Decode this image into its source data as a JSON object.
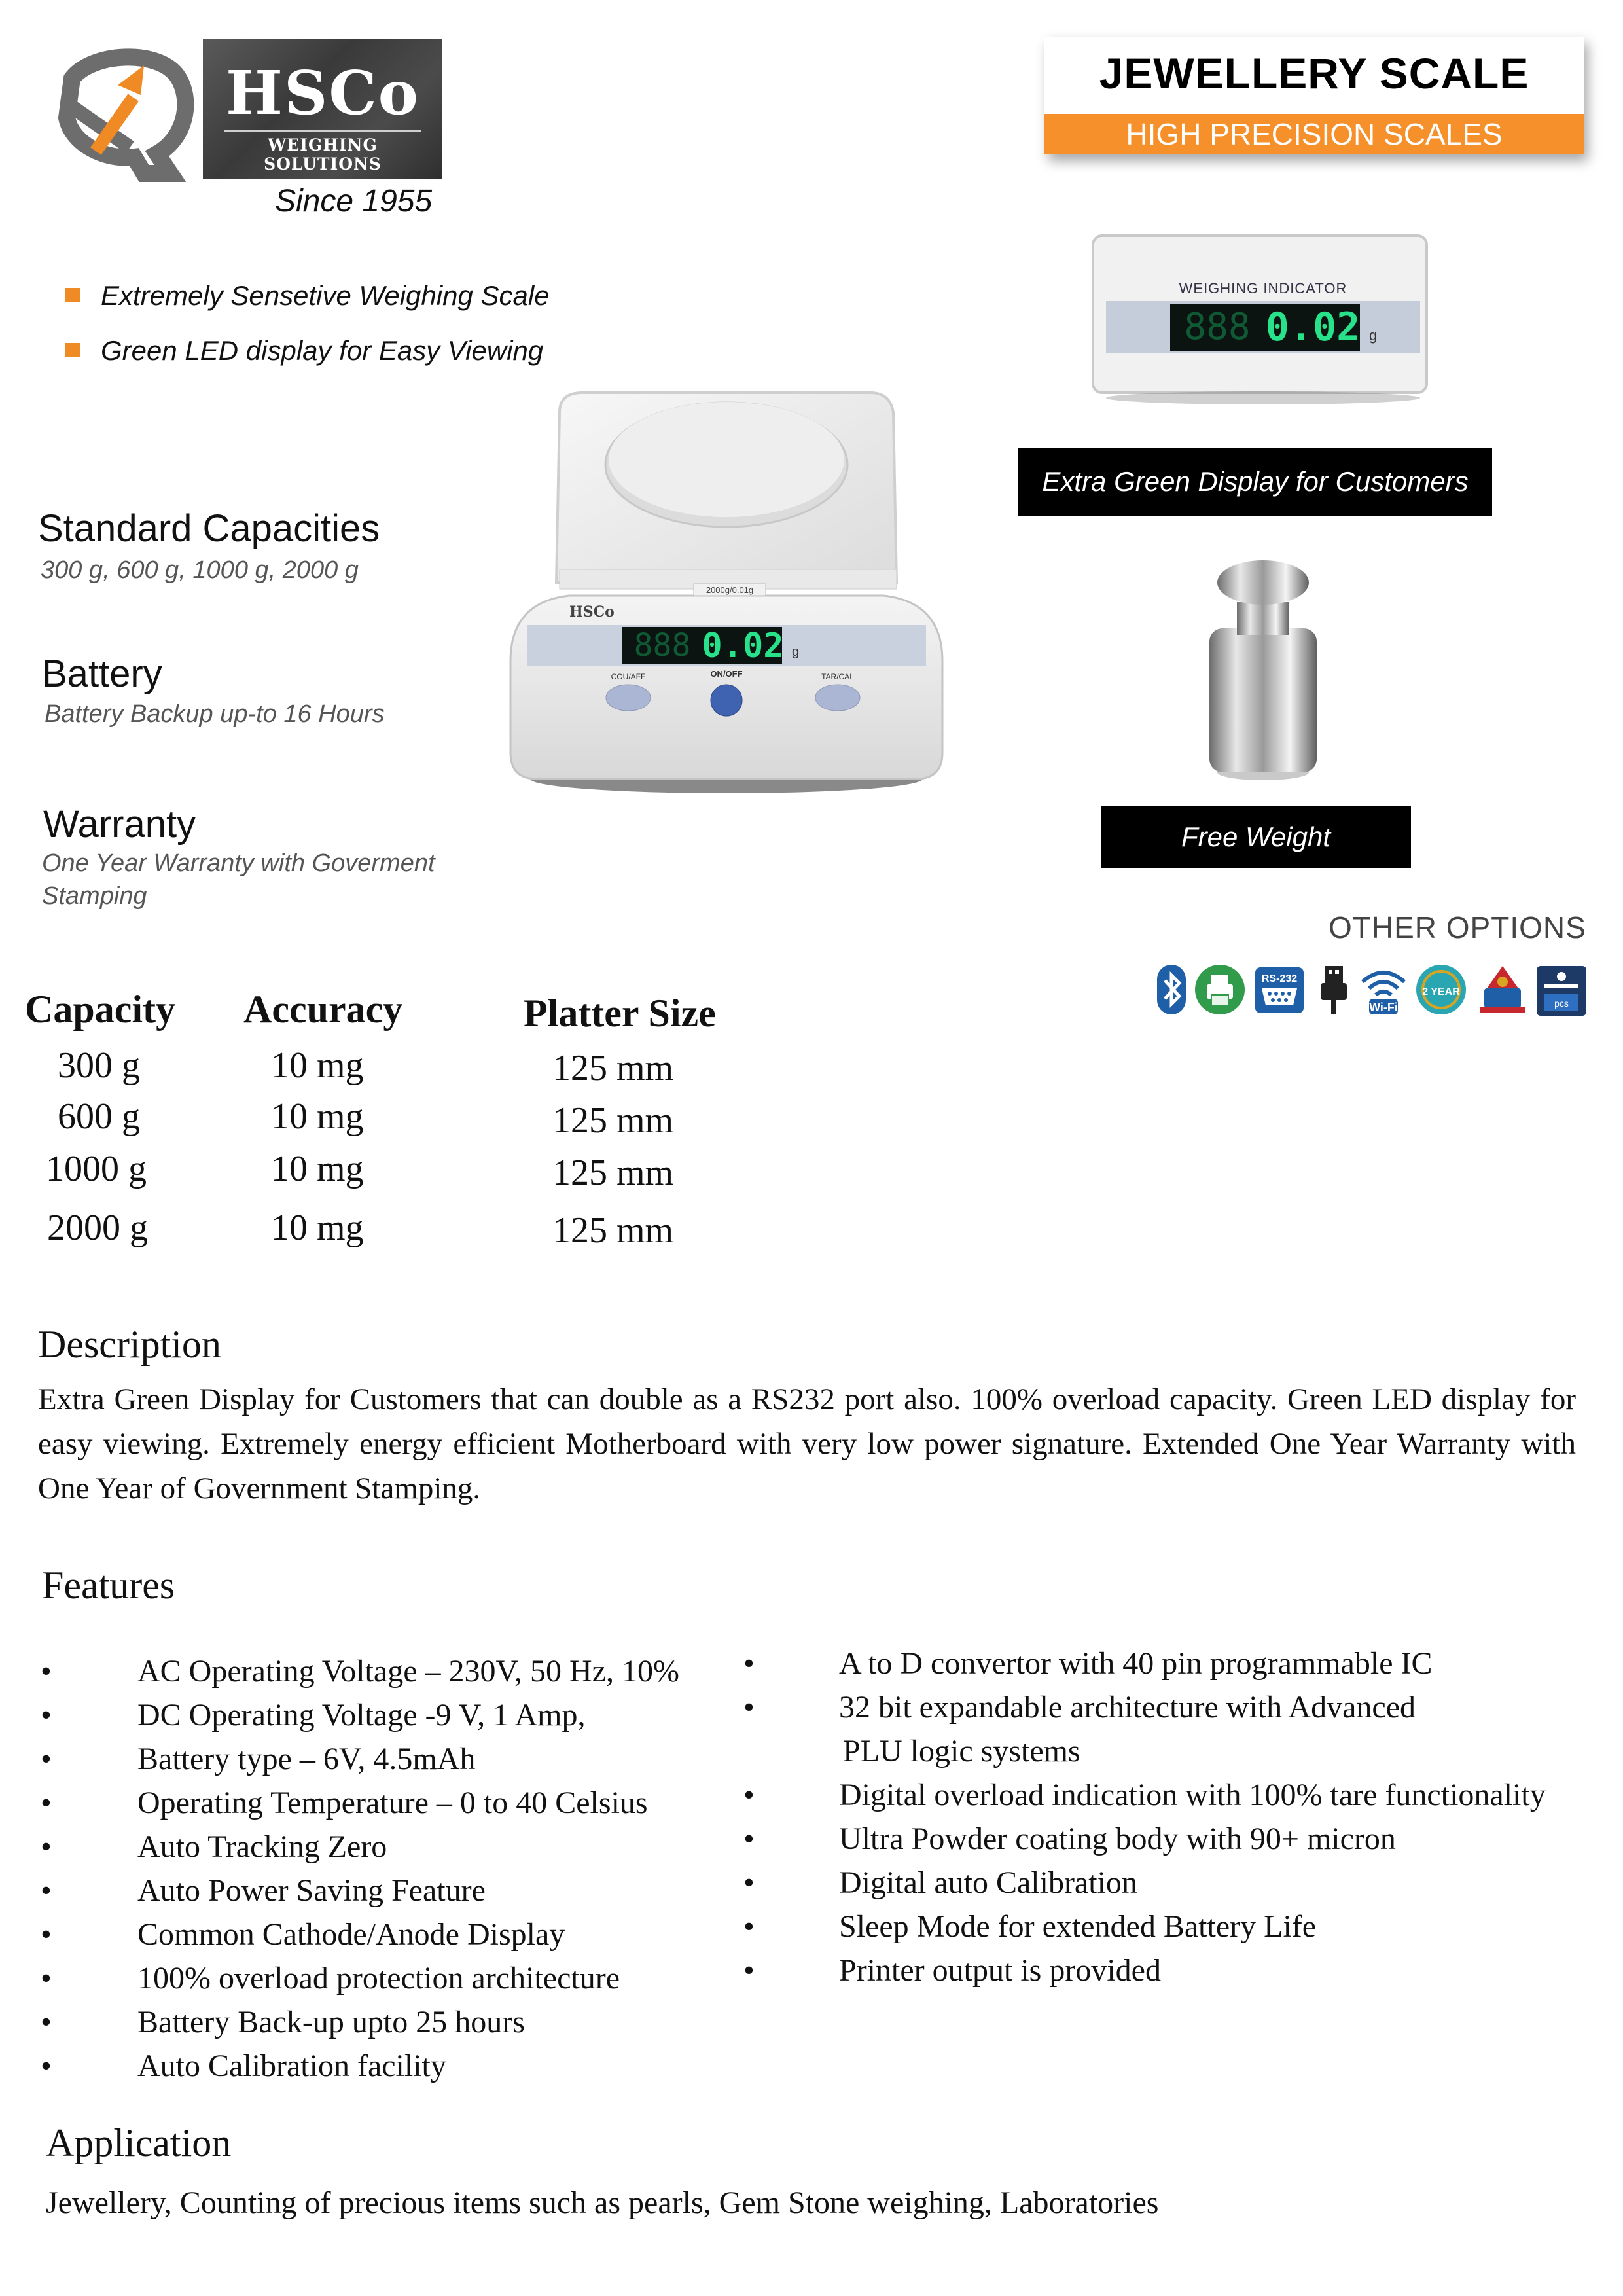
{
  "brand": {
    "name": "HSCo",
    "tagline": "WEIGHING SOLUTIONS",
    "since": "Since 1955"
  },
  "header": {
    "title": "JEWELLERY SCALE",
    "subtitle": "HIGH PRECISION SCALES"
  },
  "highlights": [
    "Extremely Sensetive Weighing Scale",
    "Green LED display for Easy Viewing"
  ],
  "specs": {
    "capacities": {
      "title": "Standard Capacities",
      "text": "300 g, 600 g, 1000 g, 2000 g"
    },
    "battery": {
      "title": "Battery",
      "text": "Battery Backup up-to 16 Hours"
    },
    "warranty": {
      "title": "Warranty",
      "text_line1": "One Year Warranty with Goverment",
      "text_line2": "Stamping"
    }
  },
  "product_image": {
    "display_reading": "0.02",
    "display_dim": "888",
    "unit": "g",
    "badge": "2000g/0.01g",
    "btn_left": "COU/AFF",
    "btn_center": "ON/OFF",
    "btn_right": "TAR/CAL",
    "logo": "HSCo"
  },
  "indicator_image": {
    "label": "WEIGHING INDICATOR",
    "reading": "0.02",
    "dim": "888",
    "unit": "g"
  },
  "captions": {
    "extra_display": "Extra Green Display for Customers",
    "free_weight": "Free Weight"
  },
  "other_options": {
    "title": "OTHER OPTIONS",
    "icons": [
      "bluetooth-icon",
      "printer-icon",
      "rs232-icon",
      "usb-icon",
      "wifi-icon",
      "warranty-2-year-icon",
      "government-stamp-icon",
      "counting-pcs-icon"
    ],
    "rs232_label": "RS-232",
    "wifi_label": "Wi-Fi",
    "warranty_label": "2 YEAR",
    "pcs_label": "pcs",
    "colors": {
      "blue": "#1e5fa8",
      "green": "#2f9b4b",
      "gold": "#d9a520",
      "red": "#c8282d"
    }
  },
  "table": {
    "headers": [
      "Capacity",
      "Accuracy",
      "Platter Size"
    ],
    "rows": [
      [
        "300 g",
        "10 mg",
        "125 mm"
      ],
      [
        "600 g",
        "10 mg",
        "125 mm"
      ],
      [
        "1000 g",
        "10 mg",
        "125 mm"
      ],
      [
        "2000 g",
        "10 mg",
        "125 mm"
      ]
    ]
  },
  "description": {
    "title": "Description",
    "body": "Extra Green Display for Customers that can double as a RS232 port also. 100% overload capacity. Green LED display for easy viewing. Extremely energy efficient Motherboard with very low power signature. Extended One Year Warranty with One Year of Government Stamping."
  },
  "features": {
    "title": "Features",
    "bullet": "•",
    "left": [
      "AC Operating Voltage – 230V, 50 Hz, 10%",
      "DC Operating Voltage -9 V, 1 Amp,",
      "Battery type – 6V, 4.5mAh",
      "Operating Temperature – 0 to 40 Celsius",
      "Auto Tracking Zero",
      "Auto Power Saving Feature",
      "Common Cathode/Anode Display",
      "100% overload protection architecture",
      "Battery Back-up upto 25 hours",
      "Auto Calibration facility"
    ],
    "right": [
      "A to D convertor with 40 pin programmable IC",
      "32 bit expandable architecture with Advanced",
      "PLU logic systems",
      "Digital overload indication with 100% tare functionality",
      "Ultra Powder coating body with 90+ micron",
      "Digital auto Calibration",
      "Sleep Mode for extended Battery Life",
      "Printer output is provided"
    ]
  },
  "application": {
    "title": "Application",
    "body": "Jewellery, Counting of precious items such as pearls, Gem Stone weighing, Laboratories"
  }
}
